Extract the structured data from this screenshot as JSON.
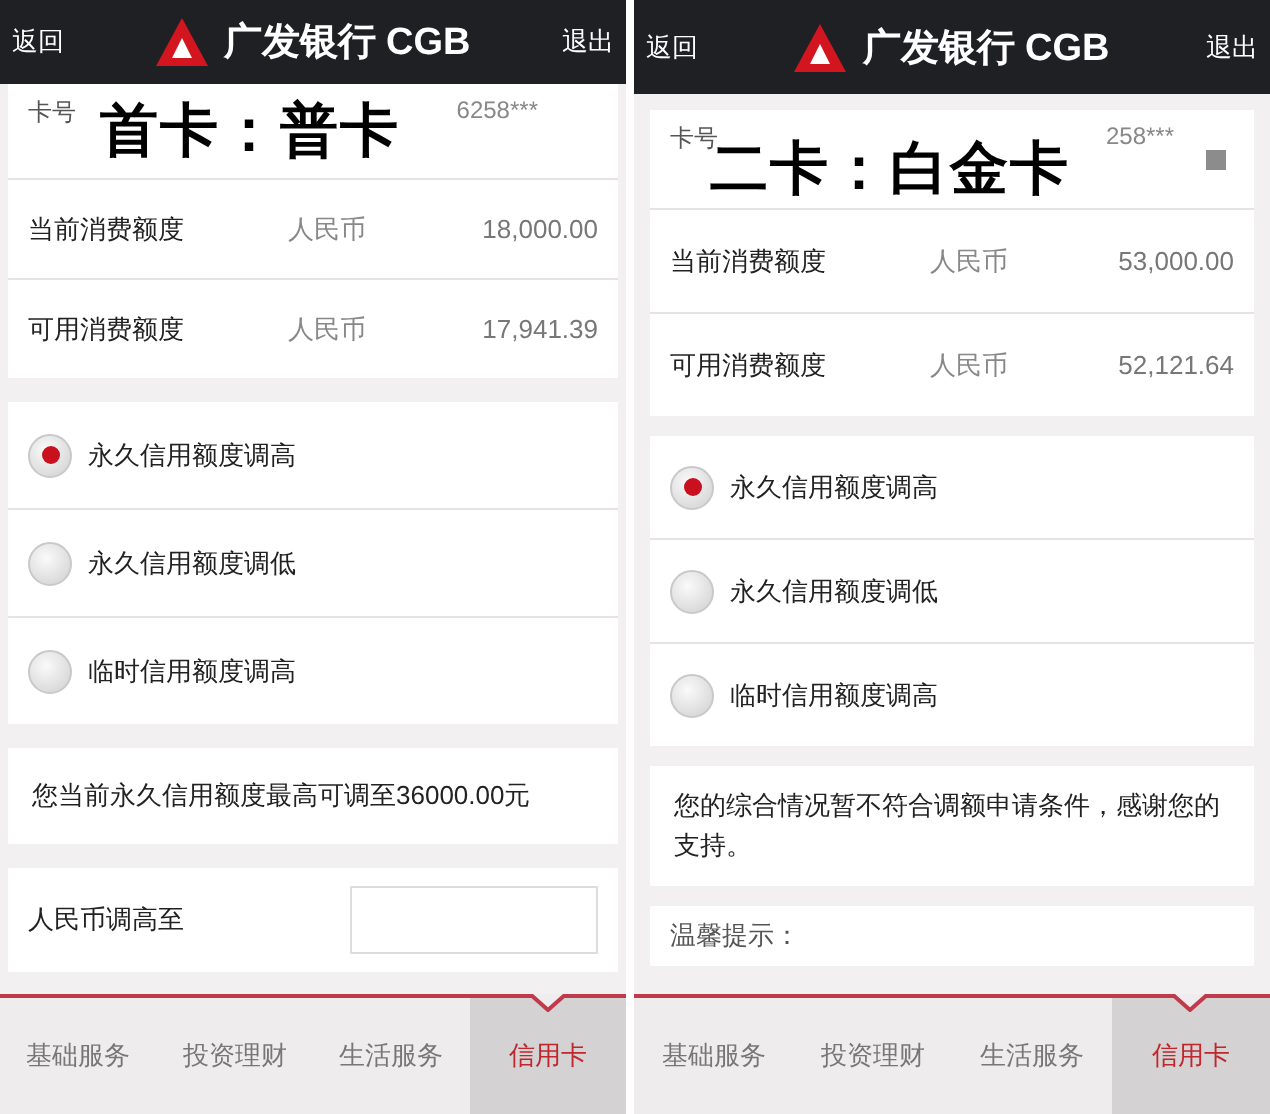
{
  "phones": [
    {
      "header": {
        "back": "返回",
        "bank_name": "广发银行 CGB",
        "exit": "退出"
      },
      "card_number": {
        "label": "卡号",
        "value": "6258***",
        "annotation": "首卡：普卡",
        "status_icon": false
      },
      "limits": [
        {
          "label": "当前消费额度",
          "currency": "人民币",
          "amount": "18,000.00"
        },
        {
          "label": "可用消费额度",
          "currency": "人民币",
          "amount": "17,941.39"
        }
      ],
      "options": [
        {
          "label": "永久信用额度调高",
          "selected": true
        },
        {
          "label": "永久信用额度调低",
          "selected": false
        },
        {
          "label": "临时信用额度调高",
          "selected": false
        }
      ],
      "blocks": [
        {
          "kind": "message",
          "text": "您当前永久信用额度最高可调至36000.00元"
        },
        {
          "kind": "input",
          "label": "人民币调高至"
        }
      ],
      "tabs": [
        {
          "label": "基础服务",
          "selected": false
        },
        {
          "label": "投资理财",
          "selected": false
        },
        {
          "label": "生活服务",
          "selected": false
        },
        {
          "label": "信用卡",
          "selected": true
        }
      ]
    },
    {
      "header": {
        "back": "返回",
        "bank_name": "广发银行 CGB",
        "exit": "退出"
      },
      "card_number": {
        "label": "卡号",
        "value": "258***",
        "annotation": "二卡：白金卡",
        "status_icon": true
      },
      "limits": [
        {
          "label": "当前消费额度",
          "currency": "人民币",
          "amount": "53,000.00"
        },
        {
          "label": "可用消费额度",
          "currency": "人民币",
          "amount": "52,121.64"
        }
      ],
      "options": [
        {
          "label": "永久信用额度调高",
          "selected": true
        },
        {
          "label": "永久信用额度调低",
          "selected": false
        },
        {
          "label": "临时信用额度调高",
          "selected": false
        }
      ],
      "blocks": [
        {
          "kind": "message",
          "text": "您的综合情况暂不符合调额申请条件，感谢您的支持。"
        },
        {
          "kind": "tip",
          "text": "温馨提示："
        }
      ],
      "tabs": [
        {
          "label": "基础服务",
          "selected": false
        },
        {
          "label": "投资理财",
          "selected": false
        },
        {
          "label": "生活服务",
          "selected": false
        },
        {
          "label": "信用卡",
          "selected": true
        }
      ]
    }
  ]
}
